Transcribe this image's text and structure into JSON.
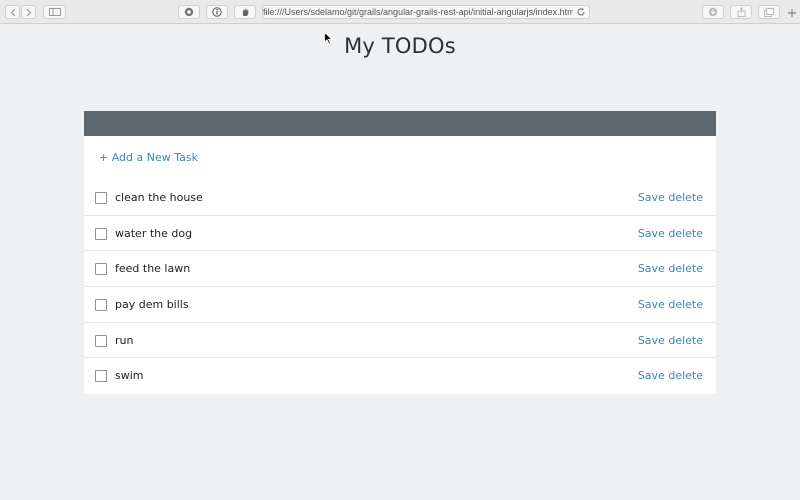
{
  "browser": {
    "url": "file:///Users/sdelamo/git/grails/angular-grails-rest-api/initial-angularjs/index.html"
  },
  "page": {
    "title": "My TODOs",
    "add_task_label": "+ Add a New Task",
    "save_label": "Save",
    "delete_label": "delete"
  },
  "tasks": [
    {
      "text": "clean the house",
      "checked": false
    },
    {
      "text": "water the dog",
      "checked": false
    },
    {
      "text": "feed the lawn",
      "checked": false
    },
    {
      "text": "pay dem bills",
      "checked": false
    },
    {
      "text": "run",
      "checked": false
    },
    {
      "text": "swim",
      "checked": false
    }
  ],
  "colors": {
    "header_bar": "#5c6770",
    "link": "#3a86b8",
    "background": "#eff0f1"
  }
}
